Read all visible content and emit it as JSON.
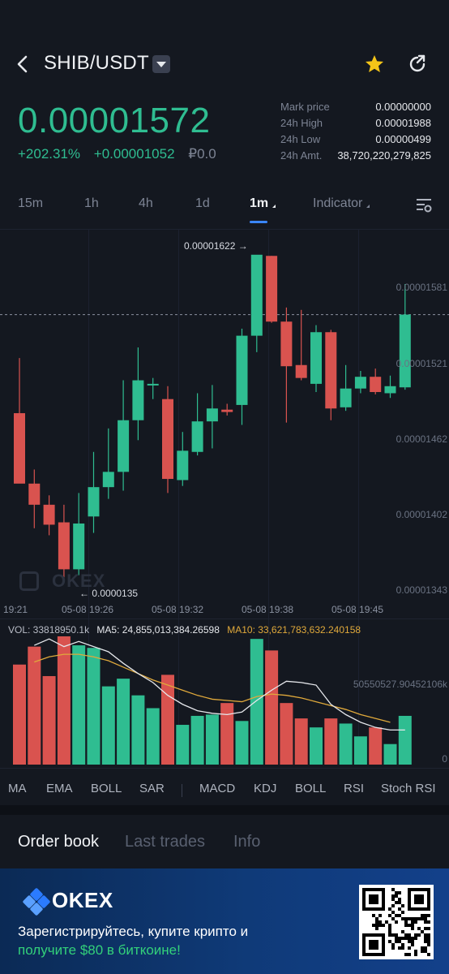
{
  "header": {
    "pair": "SHIB/USDT"
  },
  "ticker": {
    "price": "0.00001572",
    "change_percent": "+202.31%",
    "change_abs": "+0.00001052",
    "local_price": "₽0.0",
    "stats": [
      {
        "label": "Mark price",
        "value": "0.00000000"
      },
      {
        "label": "24h High",
        "value": "0.00001988"
      },
      {
        "label": "24h Low",
        "value": "0.00000499"
      },
      {
        "label": "24h Amt.",
        "value": "38,720,220,279,825"
      }
    ]
  },
  "timeframes": [
    "15m",
    "1h",
    "4h",
    "1d",
    "1m",
    "Indicator"
  ],
  "active_timeframe": "1m",
  "chart": {
    "high_marker": "0.00001622",
    "low_marker": "0.0000135",
    "y_ticks": [
      "0.00001581",
      "0.00001521",
      "0.00001462",
      "0.00001402",
      "0.00001343"
    ],
    "x_ticks": [
      "19:21",
      "05-08 19:26",
      "05-08 19:32",
      "05-08 19:38",
      "05-08 19:45"
    ],
    "watermark": "OKEX"
  },
  "chart_data": {
    "type": "candlestick",
    "colors": {
      "up": "#2fbd91",
      "down": "#d9534f",
      "ma5": "#e6e8ec",
      "ma10": "#e0a93b"
    },
    "candles": [
      {
        "o": 1.488e-05,
        "h": 1.535e-05,
        "l": 1.435e-05,
        "c": 1.428e-05
      },
      {
        "o": 1.428e-05,
        "h": 1.44e-05,
        "l": 1.39e-05,
        "c": 1.41e-05
      },
      {
        "o": 1.41e-05,
        "h": 1.418e-05,
        "l": 1.384e-05,
        "c": 1.393e-05
      },
      {
        "o": 1.395e-05,
        "h": 1.41e-05,
        "l": 1.348e-05,
        "c": 1.355e-05
      },
      {
        "o": 1.355e-05,
        "h": 1.42e-05,
        "l": 1.35e-05,
        "c": 1.394e-05
      },
      {
        "o": 1.4e-05,
        "h": 1.455e-05,
        "l": 1.386e-05,
        "c": 1.425e-05
      },
      {
        "o": 1.425e-05,
        "h": 1.475e-05,
        "l": 1.415e-05,
        "c": 1.438e-05
      },
      {
        "o": 1.438e-05,
        "h": 1.516e-05,
        "l": 1.422e-05,
        "c": 1.482e-05
      },
      {
        "o": 1.482e-05,
        "h": 1.544e-05,
        "l": 1.465e-05,
        "c": 1.516e-05
      },
      {
        "o": 1.512e-05,
        "h": 1.518e-05,
        "l": 1.5e-05,
        "c": 1.513e-05
      },
      {
        "o": 1.5e-05,
        "h": 1.511e-05,
        "l": 1.42e-05,
        "c": 1.432e-05
      },
      {
        "o": 1.431e-05,
        "h": 1.472e-05,
        "l": 1.426e-05,
        "c": 1.456e-05
      },
      {
        "o": 1.455e-05,
        "h": 1.505e-05,
        "l": 1.452e-05,
        "c": 1.481e-05
      },
      {
        "o": 1.481e-05,
        "h": 1.512e-05,
        "l": 1.458e-05,
        "c": 1.492e-05
      },
      {
        "o": 1.491e-05,
        "h": 1.496e-05,
        "l": 1.486e-05,
        "c": 1.489e-05
      },
      {
        "o": 1.495e-05,
        "h": 1.56e-05,
        "l": 1.478e-05,
        "c": 1.554e-05
      },
      {
        "o": 1.554e-05,
        "h": 1.622e-05,
        "l": 1.54e-05,
        "c": 1.623e-05
      },
      {
        "o": 1.622e-05,
        "h": 1.622e-05,
        "l": 1.565e-05,
        "c": 1.566e-05
      },
      {
        "o": 1.566e-05,
        "h": 1.578e-05,
        "l": 1.48e-05,
        "c": 1.528e-05
      },
      {
        "o": 1.529e-05,
        "h": 1.576e-05,
        "l": 1.516e-05,
        "c": 1.518e-05
      },
      {
        "o": 1.513e-05,
        "h": 1.563e-05,
        "l": 1.506e-05,
        "c": 1.557e-05
      },
      {
        "o": 1.557e-05,
        "h": 1.559e-05,
        "l": 1.482e-05,
        "c": 1.492e-05
      },
      {
        "o": 1.493e-05,
        "h": 1.529e-05,
        "l": 1.49e-05,
        "c": 1.509e-05
      },
      {
        "o": 1.509e-05,
        "h": 1.524e-05,
        "l": 1.505e-05,
        "c": 1.519e-05
      },
      {
        "o": 1.519e-05,
        "h": 1.526e-05,
        "l": 1.504e-05,
        "c": 1.506e-05
      },
      {
        "o": 1.505e-05,
        "h": 1.52e-05,
        "l": 1.501e-05,
        "c": 1.511e-05
      },
      {
        "o": 1.51e-05,
        "h": 1.598e-05,
        "l": 1.508e-05,
        "c": 1.572e-05
      }
    ],
    "last_price": 1.572e-05,
    "volume": [
      0.78,
      0.92,
      0.69,
      1.0,
      0.93,
      0.91,
      0.61,
      0.67,
      0.54,
      0.44,
      0.7,
      0.31,
      0.38,
      0.39,
      0.48,
      0.34,
      0.98,
      0.89,
      0.48,
      0.36,
      0.29,
      0.36,
      0.32,
      0.22,
      0.29,
      0.16,
      0.38
    ],
    "ma5": [
      0.93,
      0.98,
      0.92,
      0.96,
      0.92,
      0.88,
      0.79,
      0.71,
      0.64,
      0.54,
      0.47,
      0.42,
      0.4,
      0.39,
      0.41,
      0.5,
      0.58,
      0.65,
      0.64,
      0.62,
      0.47,
      0.39,
      0.33,
      0.29,
      0.27,
      0.27
    ],
    "ma10": [
      0.8,
      0.84,
      0.86,
      0.86,
      0.84,
      0.81,
      0.76,
      0.71,
      0.66,
      0.62,
      0.58,
      0.54,
      0.51,
      0.5,
      0.49,
      0.53,
      0.55,
      0.54,
      0.52,
      0.49,
      0.46,
      0.43,
      0.39,
      0.36,
      0.33
    ],
    "ylim": [
      1.32e-05,
      1.645e-05
    ]
  },
  "volume_panel": {
    "vol_label": "VOL: 33818950.1k",
    "ma5_label": "MA5: 24,855,013,384.26598",
    "ma10_label": "MA10: 33,621,783,632.240158",
    "max_label": "50550527.90452106k",
    "zero_label": "0"
  },
  "indicators": [
    "MA",
    "EMA",
    "BOLL",
    "SAR",
    "MACD",
    "KDJ",
    "BOLL",
    "RSI",
    "Stoch RSI"
  ],
  "bottom_tabs": [
    "Order book",
    "Last trades",
    "Info"
  ],
  "banner": {
    "brand": "OKEX",
    "line1": "Зарегистрируйтесь, купите крипто и",
    "line2": "получите $80 в биткоине!"
  }
}
